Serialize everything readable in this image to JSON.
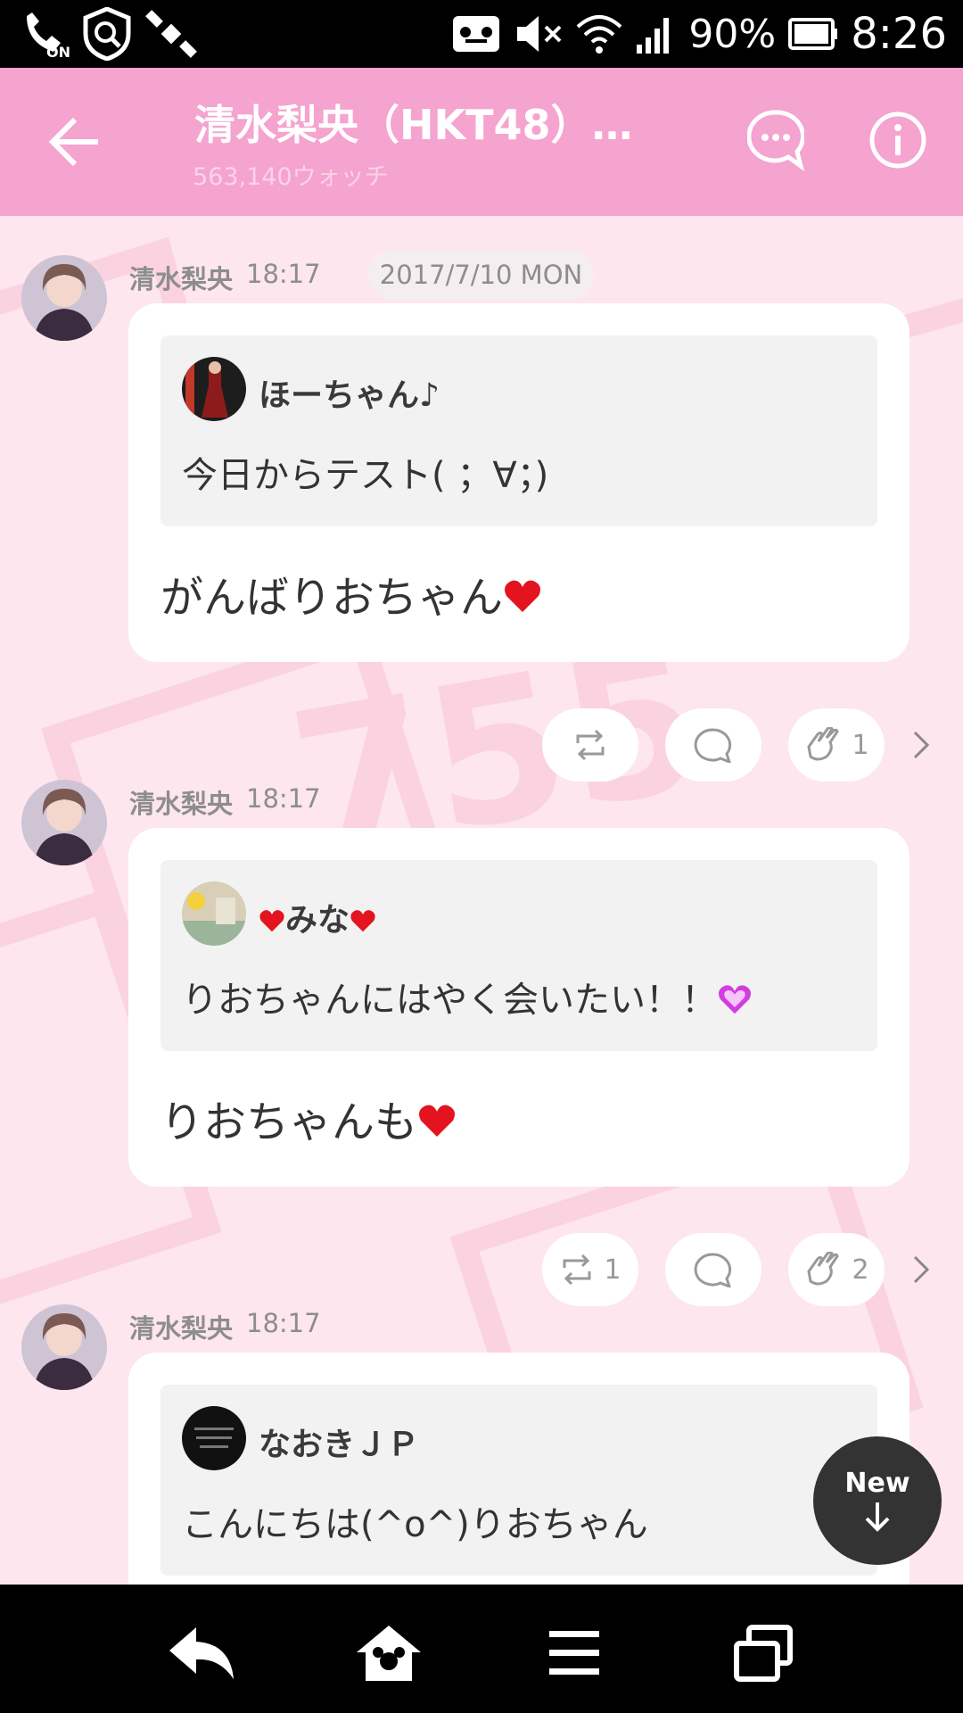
{
  "status_bar": {
    "battery": "90%",
    "time": "8:26"
  },
  "header": {
    "title": "清水梨央（HKT48）…",
    "watch_count": "563,140ウォッチ"
  },
  "date_label": "2017/7/10 MON",
  "posts": [
    {
      "author": "清水梨央",
      "time": "18:17",
      "quote_author": "ほーちゃん♪",
      "quote_text": "今日からテスト( ；∀；)",
      "message": "がんばりおちゃん",
      "retweet_count": "",
      "clap_count": "1"
    },
    {
      "author": "清水梨央",
      "time": "18:17",
      "quote_author": "みな",
      "quote_text": "りおちゃんにはやく会いたい！！",
      "message": "りおちゃんも",
      "retweet_count": "1",
      "clap_count": "2"
    },
    {
      "author": "清水梨央",
      "time": "18:17",
      "quote_author": "なおきＪＰ",
      "quote_text": "こんにちは(^o^)りおちゃん"
    }
  ],
  "new_button": {
    "label": "New"
  },
  "colors": {
    "header_pink": "#f5a3cf",
    "background_pink": "#fde6ee",
    "heart_red": "#e3141f",
    "heart_purple": "#d23ce0"
  },
  "icons": [
    "back-arrow-icon",
    "chat-bubble-icon",
    "info-icon",
    "retweet-icon",
    "comment-icon",
    "clap-icon",
    "chevron-right-icon",
    "reply-icon",
    "home-icon",
    "menu-icon",
    "windows-icon"
  ]
}
